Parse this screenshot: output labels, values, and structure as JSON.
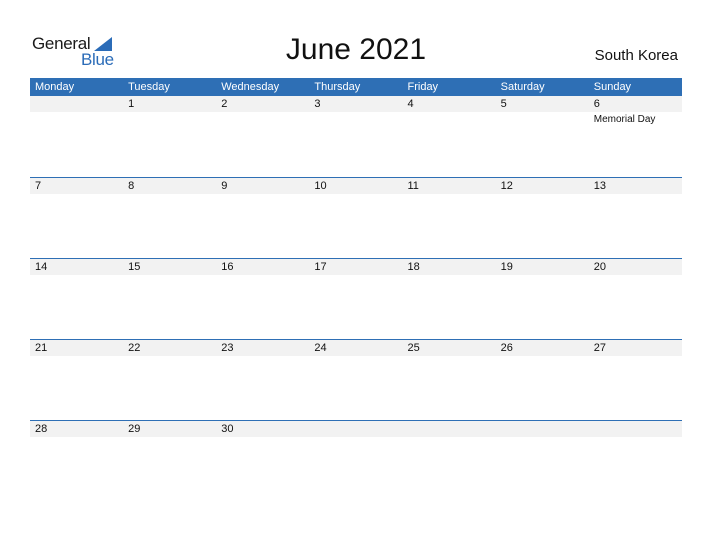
{
  "logo": {
    "word1": "General",
    "word2": "Blue"
  },
  "title": "June 2021",
  "country": "South Korea",
  "colors": {
    "accent": "#2e6fb5",
    "strip": "#f2f2f2"
  },
  "weekdays": [
    "Monday",
    "Tuesday",
    "Wednesday",
    "Thursday",
    "Friday",
    "Saturday",
    "Sunday"
  ],
  "weeks": [
    {
      "days": [
        {
          "date": "",
          "event": ""
        },
        {
          "date": "1",
          "event": ""
        },
        {
          "date": "2",
          "event": ""
        },
        {
          "date": "3",
          "event": ""
        },
        {
          "date": "4",
          "event": ""
        },
        {
          "date": "5",
          "event": ""
        },
        {
          "date": "6",
          "event": "Memorial Day"
        }
      ]
    },
    {
      "days": [
        {
          "date": "7",
          "event": ""
        },
        {
          "date": "8",
          "event": ""
        },
        {
          "date": "9",
          "event": ""
        },
        {
          "date": "10",
          "event": ""
        },
        {
          "date": "11",
          "event": ""
        },
        {
          "date": "12",
          "event": ""
        },
        {
          "date": "13",
          "event": ""
        }
      ]
    },
    {
      "days": [
        {
          "date": "14",
          "event": ""
        },
        {
          "date": "15",
          "event": ""
        },
        {
          "date": "16",
          "event": ""
        },
        {
          "date": "17",
          "event": ""
        },
        {
          "date": "18",
          "event": ""
        },
        {
          "date": "19",
          "event": ""
        },
        {
          "date": "20",
          "event": ""
        }
      ]
    },
    {
      "days": [
        {
          "date": "21",
          "event": ""
        },
        {
          "date": "22",
          "event": ""
        },
        {
          "date": "23",
          "event": ""
        },
        {
          "date": "24",
          "event": ""
        },
        {
          "date": "25",
          "event": ""
        },
        {
          "date": "26",
          "event": ""
        },
        {
          "date": "27",
          "event": ""
        }
      ]
    },
    {
      "days": [
        {
          "date": "28",
          "event": ""
        },
        {
          "date": "29",
          "event": ""
        },
        {
          "date": "30",
          "event": ""
        },
        {
          "date": "",
          "event": ""
        },
        {
          "date": "",
          "event": ""
        },
        {
          "date": "",
          "event": ""
        },
        {
          "date": "",
          "event": ""
        }
      ]
    }
  ]
}
